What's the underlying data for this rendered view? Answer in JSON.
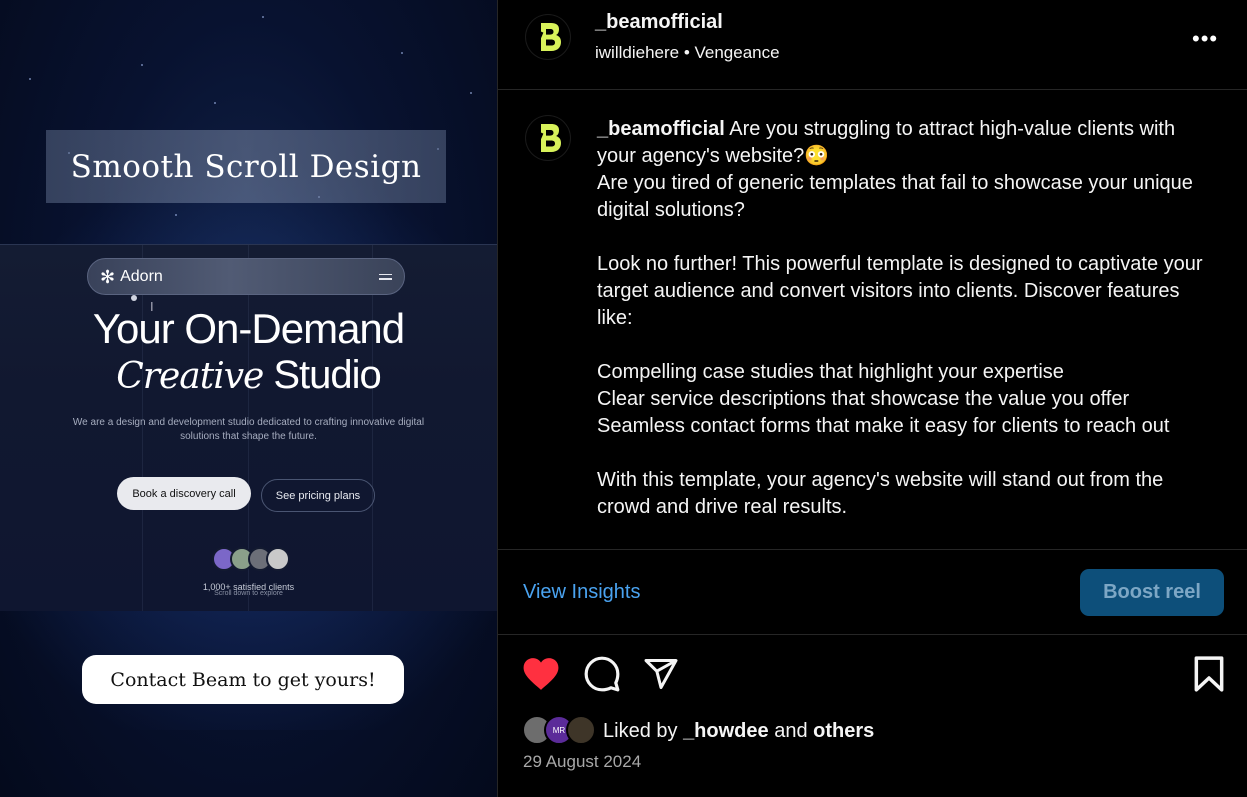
{
  "reel": {
    "title": "Smooth Scroll Design",
    "mock": {
      "logo": "Adorn",
      "headline_1": "Your On-Demand",
      "headline_2_serif": "Creative",
      "headline_2_rest": "Studio",
      "description": "We are a design and development studio dedicated to crafting innovative digital solutions that shape the future.",
      "primary_button": "Book a discovery call",
      "secondary_button": "See pricing plans",
      "clients": "1,000+ satisfied clients",
      "scroll_hint": "Scroll down to explore"
    },
    "cta": "Contact Beam to get yours!"
  },
  "header": {
    "username": "_beamofficial",
    "subtitle": "iwilldiehere • Vengeance",
    "more_icon": "more-horizontal-icon"
  },
  "caption": {
    "username": "_beamofficial",
    "text": " Are you struggling to attract high-value clients with your agency's website?😳\nAre you tired of generic templates that fail to showcase your unique digital solutions?\n\nLook no further! This powerful template is designed to captivate your target audience and convert visitors into clients. Discover features like:\n\nCompelling case studies that highlight your expertise\nClear service descriptions that showcase the value you offer\nSeamless contact forms that make it easy for clients to reach out\n\nWith this template, your agency's website will stand out from the crowd and drive real results."
  },
  "actions": {
    "view_insights": "View Insights",
    "boost": "Boost reel",
    "icons": [
      "heart-icon",
      "comment-icon",
      "share-icon",
      "bookmark-icon"
    ]
  },
  "likes": {
    "prefix": "Liked by ",
    "user": "_howdee",
    "middle": " and ",
    "others": "others",
    "avatar_2_initials": "MR"
  },
  "date": "29 August 2024",
  "colors": {
    "like_red": "#ff3040",
    "link_blue": "#4aa3f0",
    "boost_bg": "#0d4f7a",
    "brand_lime": "#d8f25a"
  }
}
